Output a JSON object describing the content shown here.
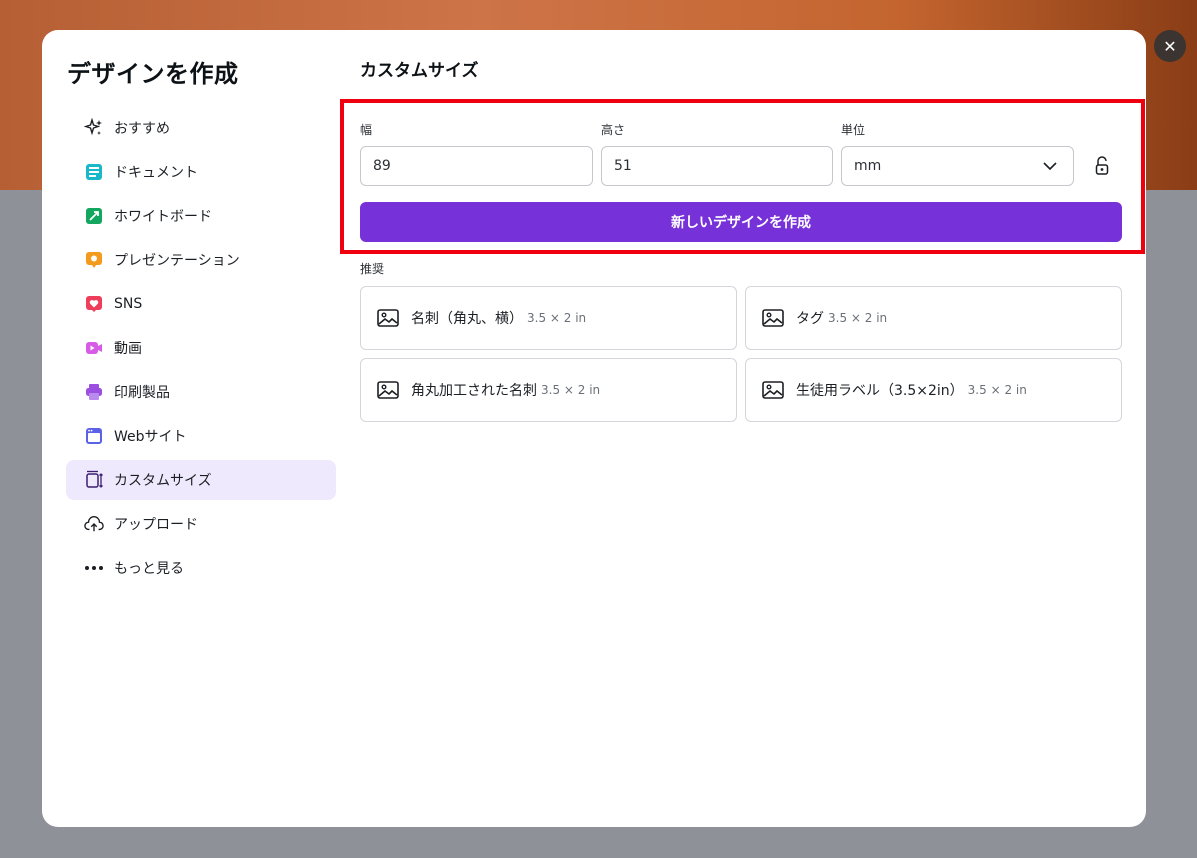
{
  "modal": {
    "title": "デザインを作成",
    "close_label": "✕"
  },
  "sidebar": {
    "items": [
      {
        "label": "おすすめ",
        "icon": "sparkles-icon"
      },
      {
        "label": "ドキュメント",
        "icon": "document-icon"
      },
      {
        "label": "ホワイトボード",
        "icon": "whiteboard-icon"
      },
      {
        "label": "プレゼンテーション",
        "icon": "presentation-icon"
      },
      {
        "label": "SNS",
        "icon": "heart-icon"
      },
      {
        "label": "動画",
        "icon": "video-icon"
      },
      {
        "label": "印刷製品",
        "icon": "printer-icon"
      },
      {
        "label": "Webサイト",
        "icon": "website-icon"
      },
      {
        "label": "カスタムサイズ",
        "icon": "custom-size-icon",
        "active": true
      },
      {
        "label": "アップロード",
        "icon": "upload-cloud-icon"
      },
      {
        "label": "もっと見る",
        "icon": "more-dots-icon"
      }
    ]
  },
  "custom_size": {
    "title": "カスタムサイズ",
    "width_label": "幅",
    "width_value": "89",
    "height_label": "高さ",
    "height_value": "51",
    "unit_label": "単位",
    "unit_value": "mm",
    "create_button": "新しいデザインを作成"
  },
  "recommended": {
    "label": "推奨",
    "cards": [
      {
        "name": "名刺（角丸、横）",
        "size": "3.5 × 2 in"
      },
      {
        "name": "タグ",
        "size": "3.5 × 2 in"
      },
      {
        "name": "角丸加工された名刺",
        "size": "3.5 × 2 in"
      },
      {
        "name": "生徒用ラベル（3.5×2in）",
        "size": "3.5 × 2 in"
      }
    ]
  },
  "colors": {
    "accent": "#7731d8",
    "highlight_border": "#f0000f",
    "active_nav_bg": "#efe9fd"
  }
}
